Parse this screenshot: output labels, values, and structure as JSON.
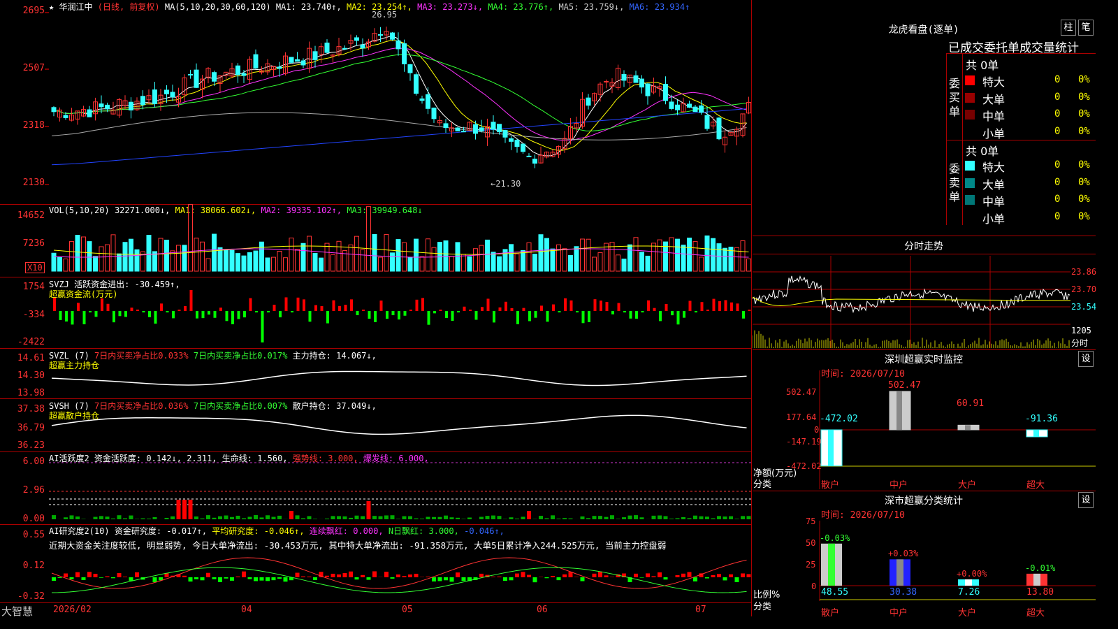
{
  "stock": {
    "star": "★",
    "name": "华润江中",
    "mode": "(日线, 前复权)"
  },
  "main_header": {
    "ma_params": "MA(5,10,20,30,60,120)",
    "ma1": "MA1: 23.740↑,",
    "ma2": "MA2: 23.254↑,",
    "ma3": "MA3: 23.273↓,",
    "ma4": "MA4: 23.776↑,",
    "ma5": "MA5: 23.759↓,",
    "ma6": "MA6: 23.934↑"
  },
  "main_axis": [
    "2695",
    "2507",
    "2318",
    "2130"
  ],
  "annotations": {
    "high": "26.95",
    "low": "←21.30"
  },
  "vol": {
    "params": "VOL(5,10,20)",
    "v": "32271.000↓,",
    "ma1": "MA1: 38066.602↓,",
    "ma2": "MA2: 39335.102↑,",
    "ma3": "MA3: 39949.648↓",
    "axis": [
      "14652",
      "7236"
    ],
    "unit": "X10"
  },
  "svzj": {
    "name": "SVZJ",
    "line": "活跃资金进出: -30.459↑,",
    "title": "超赢资金流(万元)",
    "axis": [
      "1754",
      "-334",
      "-2422"
    ]
  },
  "svzl": {
    "name": "SVZL (7)",
    "buy": "7日内买卖净占比0.033%",
    "sell": "7日内买卖净占比0.017%",
    "hold": "主力持仓: 14.067↓,",
    "title": "超赢主力持仓",
    "axis": [
      "14.61",
      "14.30",
      "13.98"
    ]
  },
  "svsh": {
    "name": "SVSH (7)",
    "buy": "7日内买卖净占比0.036%",
    "sell": "7日内买卖净占比0.007%",
    "hold": "散户持仓: 37.049↓,",
    "title": "超赢散户持仓",
    "axis": [
      "37.38",
      "36.79",
      "36.23"
    ]
  },
  "ai1": {
    "name": "AI活跃度2",
    "active": "资金活跃度: 0.142↓,",
    "v2": "2.311,",
    "life": "生命线: 1.560,",
    "strong": "强势线: 3.000,",
    "burst": "爆发线: 6.000,",
    "axis": [
      "6.00",
      "2.96",
      "0.00"
    ]
  },
  "ai2": {
    "name": "AI研究度2(10)",
    "research": "资金研究度: -0.017↑,",
    "avg": "平均研究度: -0.046↑,",
    "red": "连续飘红: 0.000,",
    "nred": "N日飘红: 3.000,",
    "last": "-0.046↑,",
    "comment": "近期大资金关注度较低, 明显弱势, 今日大单净流出: -30.453万元, 其中特大单净流出: -91.358万元, 大单5日累计净入244.525万元, 当前主力控盘弱",
    "axis": [
      "0.55",
      "0.12",
      "-0.32"
    ]
  },
  "xaxis": {
    "brand": "大智慧",
    "labels": [
      "2026/02",
      "04",
      "05",
      "06",
      "07"
    ]
  },
  "dragon": {
    "title": "龙虎看盘(逐单)",
    "btn1": "柱",
    "btn2": "笔",
    "stats_title": "已成交委托单成交量统计",
    "buy_label": "委买单",
    "sell_label": "委卖单",
    "buy_total": "共 0单",
    "sell_total": "共 0单",
    "buy_rows": [
      {
        "label": "特大",
        "count": "0",
        "pct": "0%",
        "color": "#f00"
      },
      {
        "label": "大单",
        "count": "0",
        "pct": "0%",
        "color": "#900"
      },
      {
        "label": "中单",
        "count": "0",
        "pct": "0%",
        "color": "#700"
      },
      {
        "label": "小单",
        "count": "0",
        "pct": "0%",
        "color": ""
      }
    ],
    "sell_rows": [
      {
        "label": "特大",
        "count": "0",
        "pct": "0%",
        "color": "#3ff"
      },
      {
        "label": "大单",
        "count": "0",
        "pct": "0%",
        "color": "#088"
      },
      {
        "label": "中单",
        "count": "0",
        "pct": "0%",
        "color": "#077"
      },
      {
        "label": "小单",
        "count": "0",
        "pct": "0%",
        "color": ""
      }
    ]
  },
  "intraday": {
    "title": "分时走势",
    "axis": [
      "23.86",
      "23.70",
      "23.54"
    ],
    "vol": "1205",
    "vol_unit": "分时"
  },
  "sz_monitor": {
    "title": "深圳超赢实时监控",
    "btn": "设",
    "time": "时间: 2026/07/10",
    "axis": [
      "502.47",
      "177.64",
      "0",
      "-147.19",
      "-472.02"
    ],
    "ylabel": "净额(万元)",
    "xlabel": "分类",
    "cats": [
      "散户",
      "中户",
      "大户",
      "超大"
    ]
  },
  "sz_class": {
    "title": "深市超赢分类统计",
    "btn": "设",
    "time": "时间: 2026/07/10",
    "axis": [
      "75",
      "50",
      "25",
      "0"
    ],
    "ylabel": "比例%",
    "xlabel": "分类",
    "cats": [
      "散户",
      "中户",
      "大户",
      "超大"
    ],
    "top": [
      "-0.03%",
      "+0.03%",
      "+0.00%",
      "-0.01%"
    ],
    "bottom": [
      "48.55",
      "30.38",
      "7.26",
      "13.80"
    ]
  },
  "chart_data": [
    {
      "type": "bar",
      "title": "深圳超赢实时监控",
      "ylabel": "净额(万元)",
      "categories": [
        "散户",
        "中户",
        "大户",
        "超大"
      ],
      "values": [
        -472.02,
        502.47,
        60.91,
        -91.36
      ],
      "ylim": [
        -472.02,
        502.47
      ]
    },
    {
      "type": "bar",
      "title": "深市超赢分类统计",
      "ylabel": "比例%",
      "categories": [
        "散户",
        "中户",
        "大户",
        "超大"
      ],
      "values": [
        48.55,
        30.38,
        7.26,
        13.8
      ],
      "change": [
        "-0.03%",
        "+0.03%",
        "+0.00%",
        "-0.01%"
      ],
      "ylim": [
        0,
        75
      ]
    }
  ]
}
